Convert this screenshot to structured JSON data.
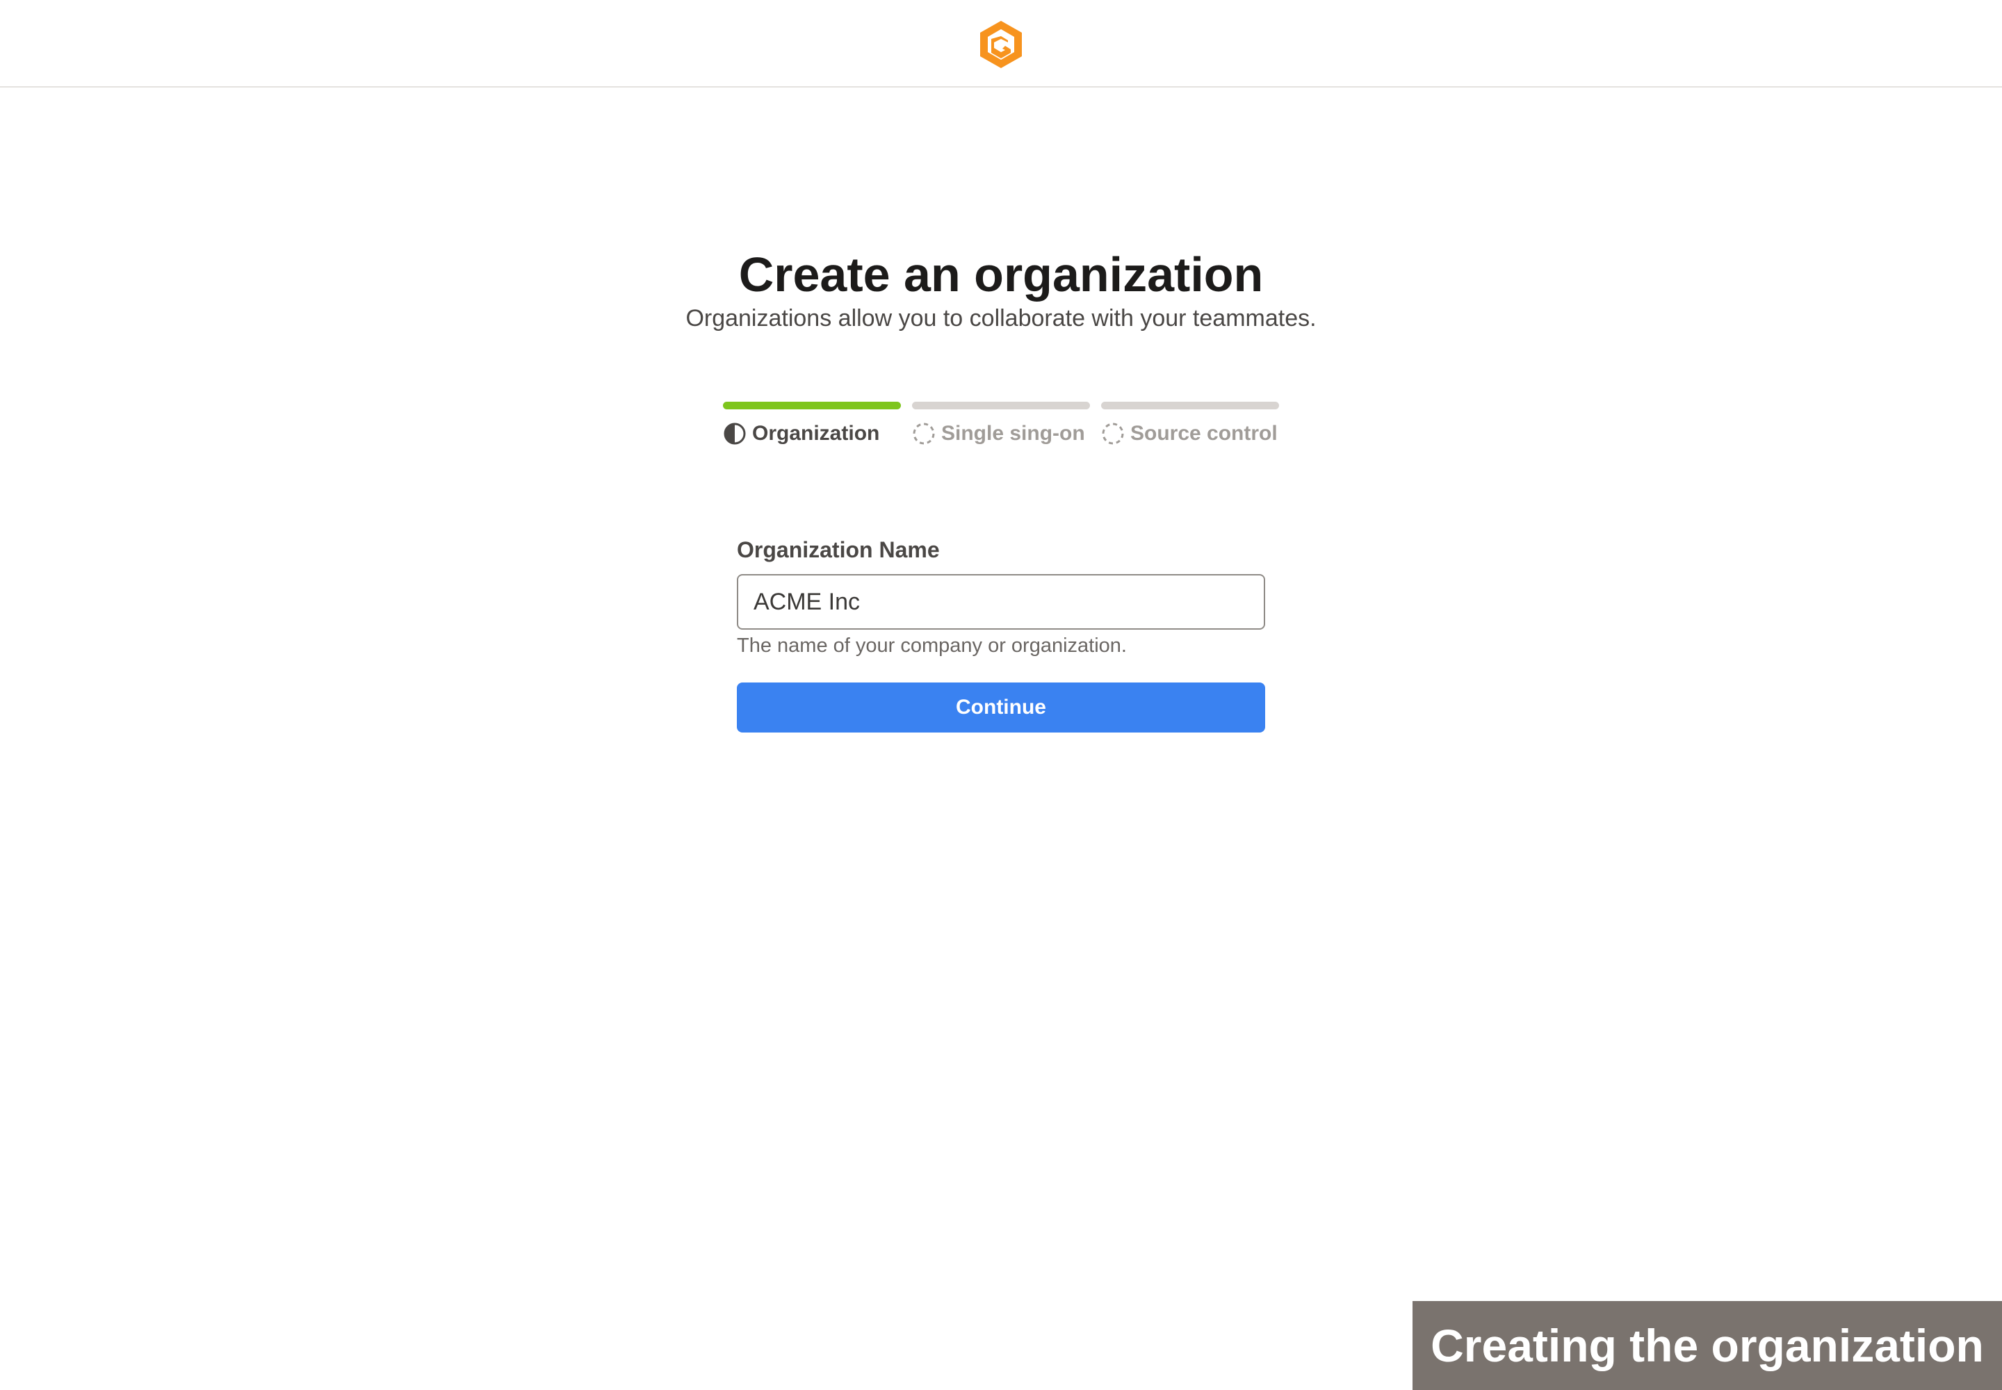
{
  "header": {
    "logo_icon": "gitbook-style-orange-hexagon-logo",
    "brand_color": "#f7931e"
  },
  "page": {
    "title": "Create an organization",
    "subtitle": "Organizations allow you to collaborate with your teammates."
  },
  "steps": [
    {
      "label": "Organization",
      "state": "in-progress",
      "icon": "half-circle-icon",
      "color": "#7ec51d"
    },
    {
      "label": "Single sing-on",
      "state": "pending",
      "icon": "dashed-circle-icon",
      "color": "#d8d4d1"
    },
    {
      "label": "Source control",
      "state": "pending",
      "icon": "dashed-circle-icon",
      "color": "#d8d4d1"
    }
  ],
  "form": {
    "label": "Organization Name",
    "value": "ACME Inc",
    "hint": "The name of your company or organization.",
    "submit_label": "Continue",
    "submit_color": "#3a82f1"
  },
  "caption": {
    "text": "Creating the organization"
  }
}
